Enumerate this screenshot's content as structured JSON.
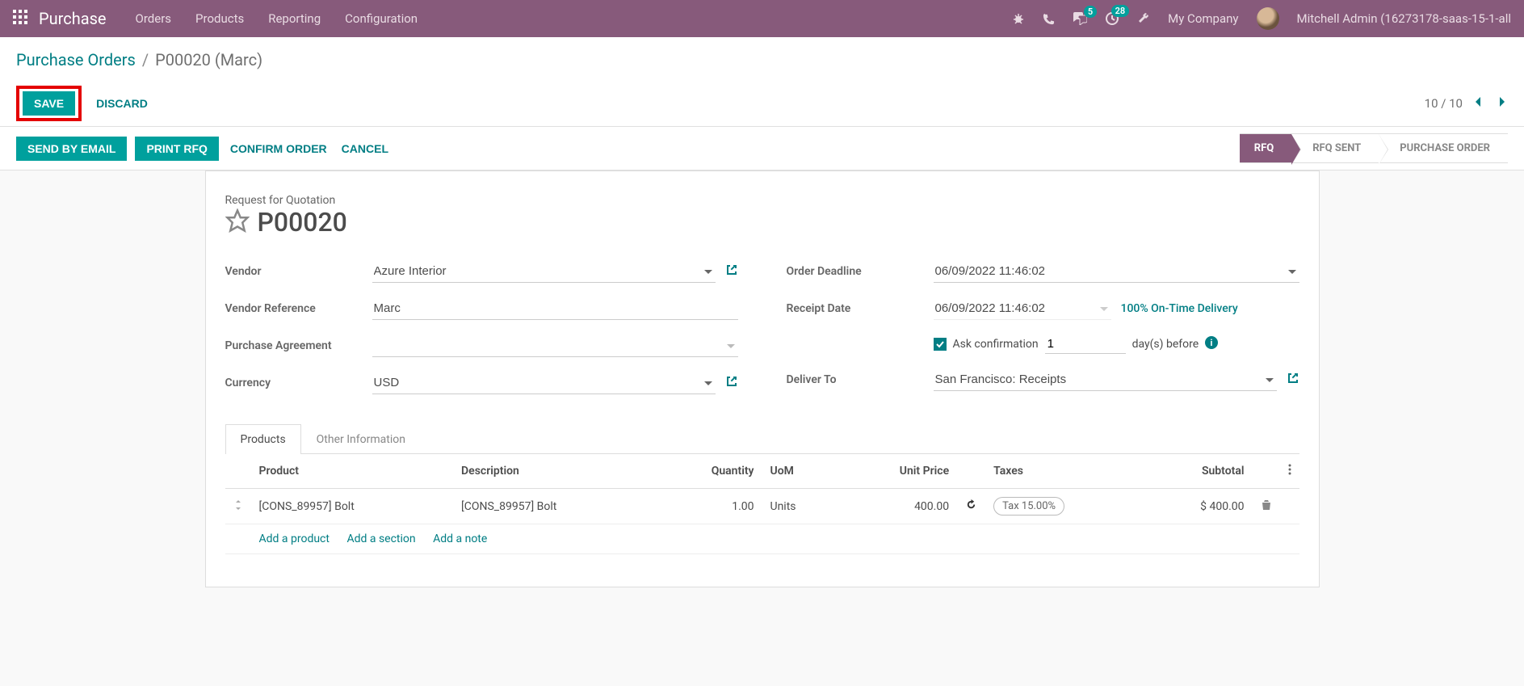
{
  "nav": {
    "brand": "Purchase",
    "links": [
      "Orders",
      "Products",
      "Reporting",
      "Configuration"
    ],
    "chat_badge": "5",
    "activity_badge": "28",
    "company": "My Company",
    "user": "Mitchell Admin (16273178-saas-15-1-all"
  },
  "breadcrumb": {
    "root": "Purchase Orders",
    "current": "P00020 (Marc)"
  },
  "buttons": {
    "save": "SAVE",
    "discard": "DISCARD",
    "send_email": "SEND BY EMAIL",
    "print_rfq": "PRINT RFQ",
    "confirm": "CONFIRM ORDER",
    "cancel": "CANCEL"
  },
  "pager": {
    "text": "10 / 10"
  },
  "stages": {
    "rfq": "RFQ",
    "sent": "RFQ SENT",
    "po": "PURCHASE ORDER"
  },
  "form": {
    "title_label": "Request for Quotation",
    "title": "P00020",
    "vendor_label": "Vendor",
    "vendor": "Azure Interior",
    "vref_label": "Vendor Reference",
    "vref": "Marc",
    "pa_label": "Purchase Agreement",
    "pa": "",
    "currency_label": "Currency",
    "currency": "USD",
    "deadline_label": "Order Deadline",
    "deadline": "06/09/2022 11:46:02",
    "receipt_label": "Receipt Date",
    "receipt": "06/09/2022 11:46:02",
    "ontime": "100% On-Time Delivery",
    "ask_label": "Ask confirmation",
    "days": "1",
    "days_after": "day(s) before",
    "deliver_label": "Deliver To",
    "deliver": "San Francisco: Receipts"
  },
  "tabs": {
    "products": "Products",
    "other": "Other Information"
  },
  "table": {
    "headers": {
      "product": "Product",
      "description": "Description",
      "qty": "Quantity",
      "uom": "UoM",
      "price": "Unit Price",
      "taxes": "Taxes",
      "subtotal": "Subtotal"
    },
    "row": {
      "product": "[CONS_89957] Bolt",
      "description": "[CONS_89957] Bolt",
      "qty": "1.00",
      "uom": "Units",
      "price": "400.00",
      "tax": "Tax 15.00%",
      "subtotal": "$ 400.00"
    },
    "add_product": "Add a product",
    "add_section": "Add a section",
    "add_note": "Add a note"
  }
}
